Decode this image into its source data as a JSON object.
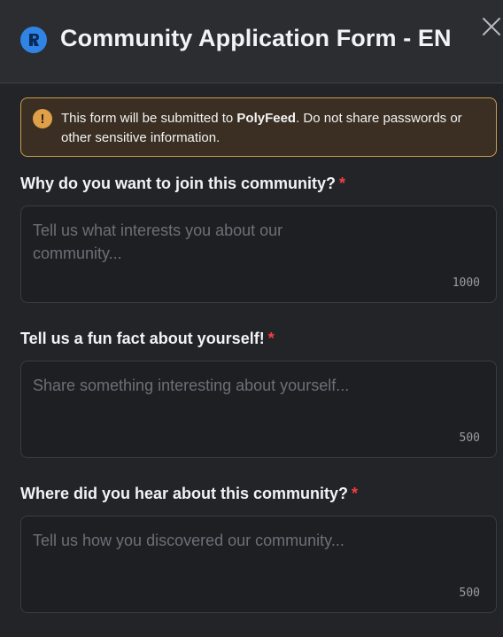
{
  "header": {
    "title": "Community Application Form - EN",
    "server_icon": "server-avatar-icon",
    "close_icon": "close-icon"
  },
  "notice": {
    "icon": "exclamation-icon",
    "text_before": "This form will be submitted to ",
    "app_name": "PolyFeed",
    "text_after": ". Do not share passwords or other sensitive information."
  },
  "fields": [
    {
      "label": "Why do you want to join this community?",
      "required_mark": "*",
      "placeholder": "Tell us what interests you about our community...",
      "counter": "1000"
    },
    {
      "label": "Tell us a fun fact about yourself!",
      "required_mark": "*",
      "placeholder": "Share something interesting about yourself...",
      "counter": "500"
    },
    {
      "label": "Where did you hear about this community?",
      "required_mark": "*",
      "placeholder": "Tell us how you discovered our community...",
      "counter": "500"
    }
  ],
  "colors": {
    "accent": "#2f84e6",
    "warning": "#e0a04a",
    "required": "#f23f43"
  }
}
